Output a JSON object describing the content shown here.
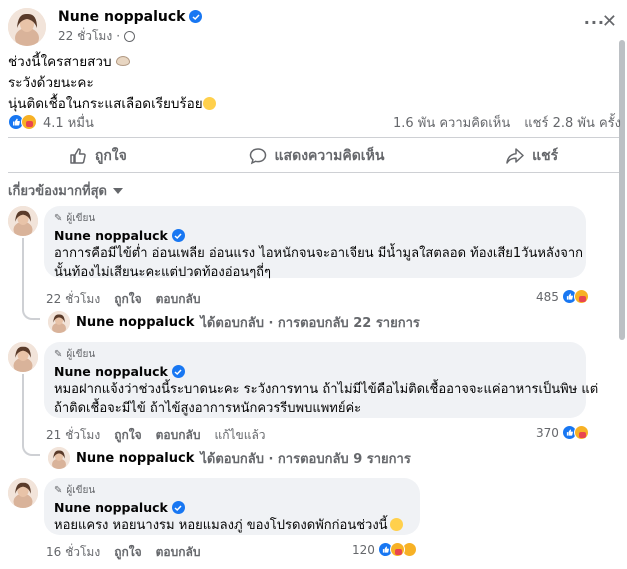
{
  "post": {
    "author": "Nune noppaluck",
    "time": "22 ชั่วโมง",
    "more_label": "···",
    "close_label": "✕",
    "text_lines": [
      "ช่วงนี้ใครสายสวบ",
      "ระวังด้วยนะคะ",
      "นุ่นติดเชื้อในกระแสเลือดเรียบร้อย"
    ],
    "reactions_count": "4.1 หมื่น",
    "comments_count": "1.6 พัน ความคิดเห็น",
    "shares_count": "แชร์ 2.8 พัน ครั้ง"
  },
  "actions": {
    "like": "ถูกใจ",
    "comment": "แสดงความคิดเห็น",
    "share": "แชร์"
  },
  "sort_label": "เกี่ยวข้องมากที่สุด",
  "comments": [
    {
      "badge": "ผู้เขียน",
      "author": "Nune noppaluck",
      "lines": [
        "อาการคือมีไข้ต่ำ อ่อนเพลีย อ่อนแรง ไอหนักจนจะอาเจียน มีน้ำมูลใสตลอด ท้องเสีย1วันหลังจาก",
        "นั้นท้องไม่เสียนะคะแต่ปวดท้องอ่อนๆถี่ๆ"
      ],
      "time": "22 ชั่วโมง",
      "like": "ถูกใจ",
      "reply": "ตอบกลับ",
      "reaction_count": "485",
      "reply_author": "Nune noppaluck",
      "reply_summary": "ได้ตอบกลับ · การตอบกลับ 22 รายการ"
    },
    {
      "badge": "ผู้เขียน",
      "author": "Nune noppaluck",
      "lines": [
        "หมอฝากแจ้งว่าช่วงนี้ระบาดนะคะ ระวังการทาน ถ้าไม่มีไข้คือไม่ติดเชื้ออาจจะแค่อาหารเป็นพิษ แต่",
        "ถ้าติดเชื้อจะมีไข้ ถ้าไข้สูงอาการหนักควรรีบพบแพทย์ค่ะ"
      ],
      "time": "21 ชั่วโมง",
      "like": "ถูกใจ",
      "reply": "ตอบกลับ",
      "edited": "แก้ไขแล้ว",
      "reaction_count": "370",
      "reply_author": "Nune noppaluck",
      "reply_summary": "ได้ตอบกลับ · การตอบกลับ 9 รายการ"
    },
    {
      "badge": "ผู้เขียน",
      "author": "Nune noppaluck",
      "lines": [
        "หอยแครง หอยนางรม หอยแมลงภู่ ของโปรดงดพักก่อนช่วงนี้"
      ],
      "time": "16 ชั่วโมง",
      "like": "ถูกใจ",
      "reply": "ตอบกลับ",
      "reaction_count": "120"
    }
  ]
}
